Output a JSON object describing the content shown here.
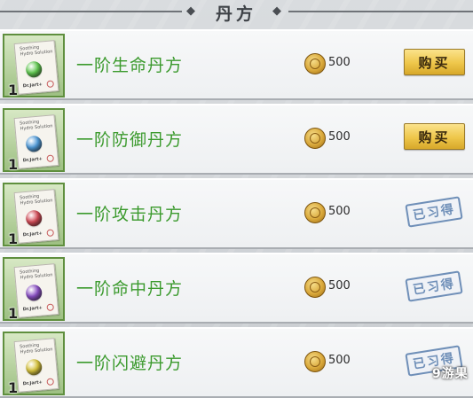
{
  "header": {
    "title": "丹方",
    "left_ornament": "◆",
    "right_ornament": "◆"
  },
  "colors": {
    "name_green": "#3b9a2d",
    "buy_gold": "#eec64a",
    "stamp_blue": "#6f8fb8",
    "icon_frame": "#5f8f3e"
  },
  "icons": {
    "coin": "gold-coin-icon",
    "recipe": "recipe-scroll-icon"
  },
  "items": [
    {
      "name": "一阶生命丹方",
      "price": "500",
      "count": "1",
      "orb_color": "#5fc84f",
      "state": "buy",
      "action_label": "购买",
      "paper_line1": "Soothing",
      "paper_line2": "Hydro Solution",
      "paper_brand": "Dr.Jart+"
    },
    {
      "name": "一阶防御丹方",
      "price": "500",
      "count": "1",
      "orb_color": "#4f9ad8",
      "state": "buy",
      "action_label": "购买",
      "paper_line1": "Soothing",
      "paper_line2": "Hydro Solution",
      "paper_brand": "Dr.Jart+"
    },
    {
      "name": "一阶攻击丹方",
      "price": "500",
      "count": "1",
      "orb_color": "#d24a55",
      "state": "learned",
      "action_label": "已习得",
      "paper_line1": "Soothing",
      "paper_line2": "Hydro Solution",
      "paper_brand": "Dr.Jart+"
    },
    {
      "name": "一阶命中丹方",
      "price": "500",
      "count": "1",
      "orb_color": "#8a4fc4",
      "state": "learned",
      "action_label": "已习得",
      "paper_line1": "Soothing",
      "paper_line2": "Hydro Solution",
      "paper_brand": "Dr.Jart+"
    },
    {
      "name": "一阶闪避丹方",
      "price": "500",
      "count": "1",
      "orb_color": "#d6c23a",
      "state": "learned",
      "action_label": "已习得",
      "paper_line1": "Soothing",
      "paper_line2": "Hydro Solution",
      "paper_brand": "Dr.Jart+"
    }
  ],
  "watermark": "9游果"
}
